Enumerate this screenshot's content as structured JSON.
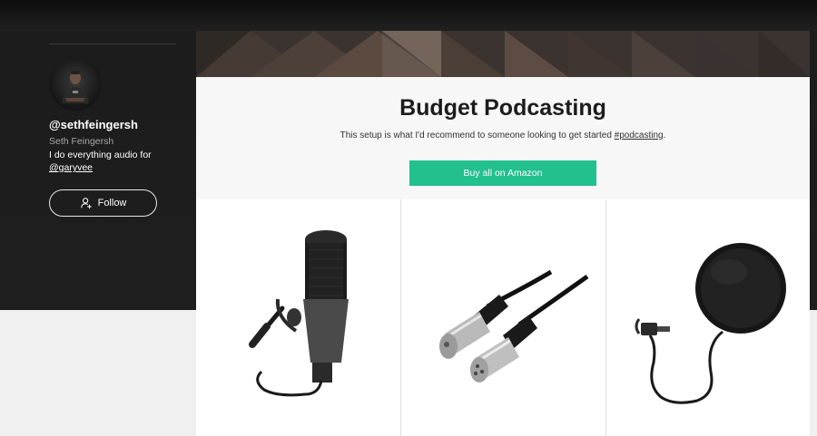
{
  "profile": {
    "handle": "@sethfeingersh",
    "name": "Seth Feingersh",
    "bio_text": "I do everything audio for",
    "bio_link": "@garyvee",
    "follow_label": "Follow"
  },
  "collection": {
    "title": "Budget Podcasting",
    "description_text": "This setup is what I'd recommend to someone looking to get started ",
    "description_tag": "#podcasting",
    "description_end": ".",
    "buy_label": "Buy all on Amazon"
  },
  "products": [
    {
      "name": "microphone"
    },
    {
      "name": "xlr-cable"
    },
    {
      "name": "pop-filter"
    }
  ],
  "colors": {
    "buy_button": "#22c08f",
    "hero_background": "#1e1e1e",
    "page_background": "#f0f0f0"
  }
}
